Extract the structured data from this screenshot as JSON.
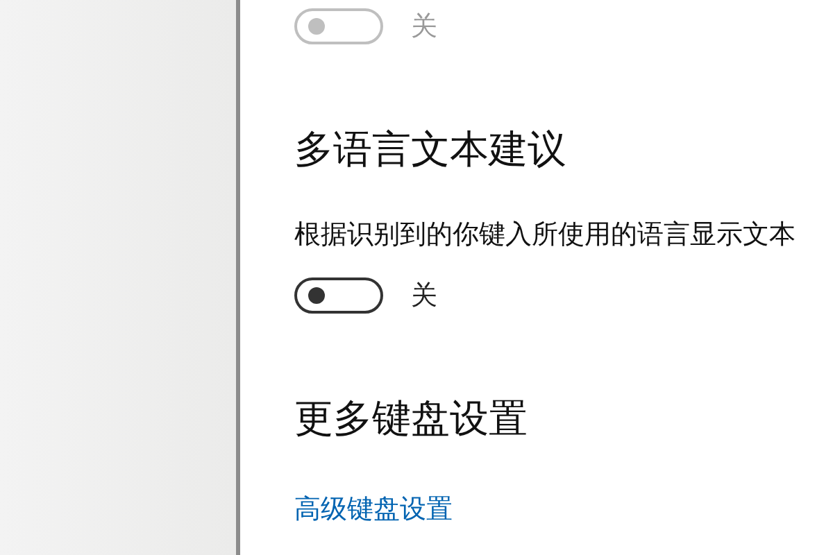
{
  "sections": [
    {
      "kind": "toggle",
      "toggle": {
        "on": false,
        "disabled": true,
        "label": "关"
      }
    },
    {
      "kind": "heading",
      "text": "多语言文本建议"
    },
    {
      "kind": "description",
      "text": "根据识别到的你键入所使用的语言显示文本"
    },
    {
      "kind": "toggle",
      "toggle": {
        "on": false,
        "disabled": false,
        "label": "关"
      }
    },
    {
      "kind": "heading",
      "text": "更多键盘设置"
    },
    {
      "kind": "link",
      "text": "高级键盘设置"
    }
  ]
}
